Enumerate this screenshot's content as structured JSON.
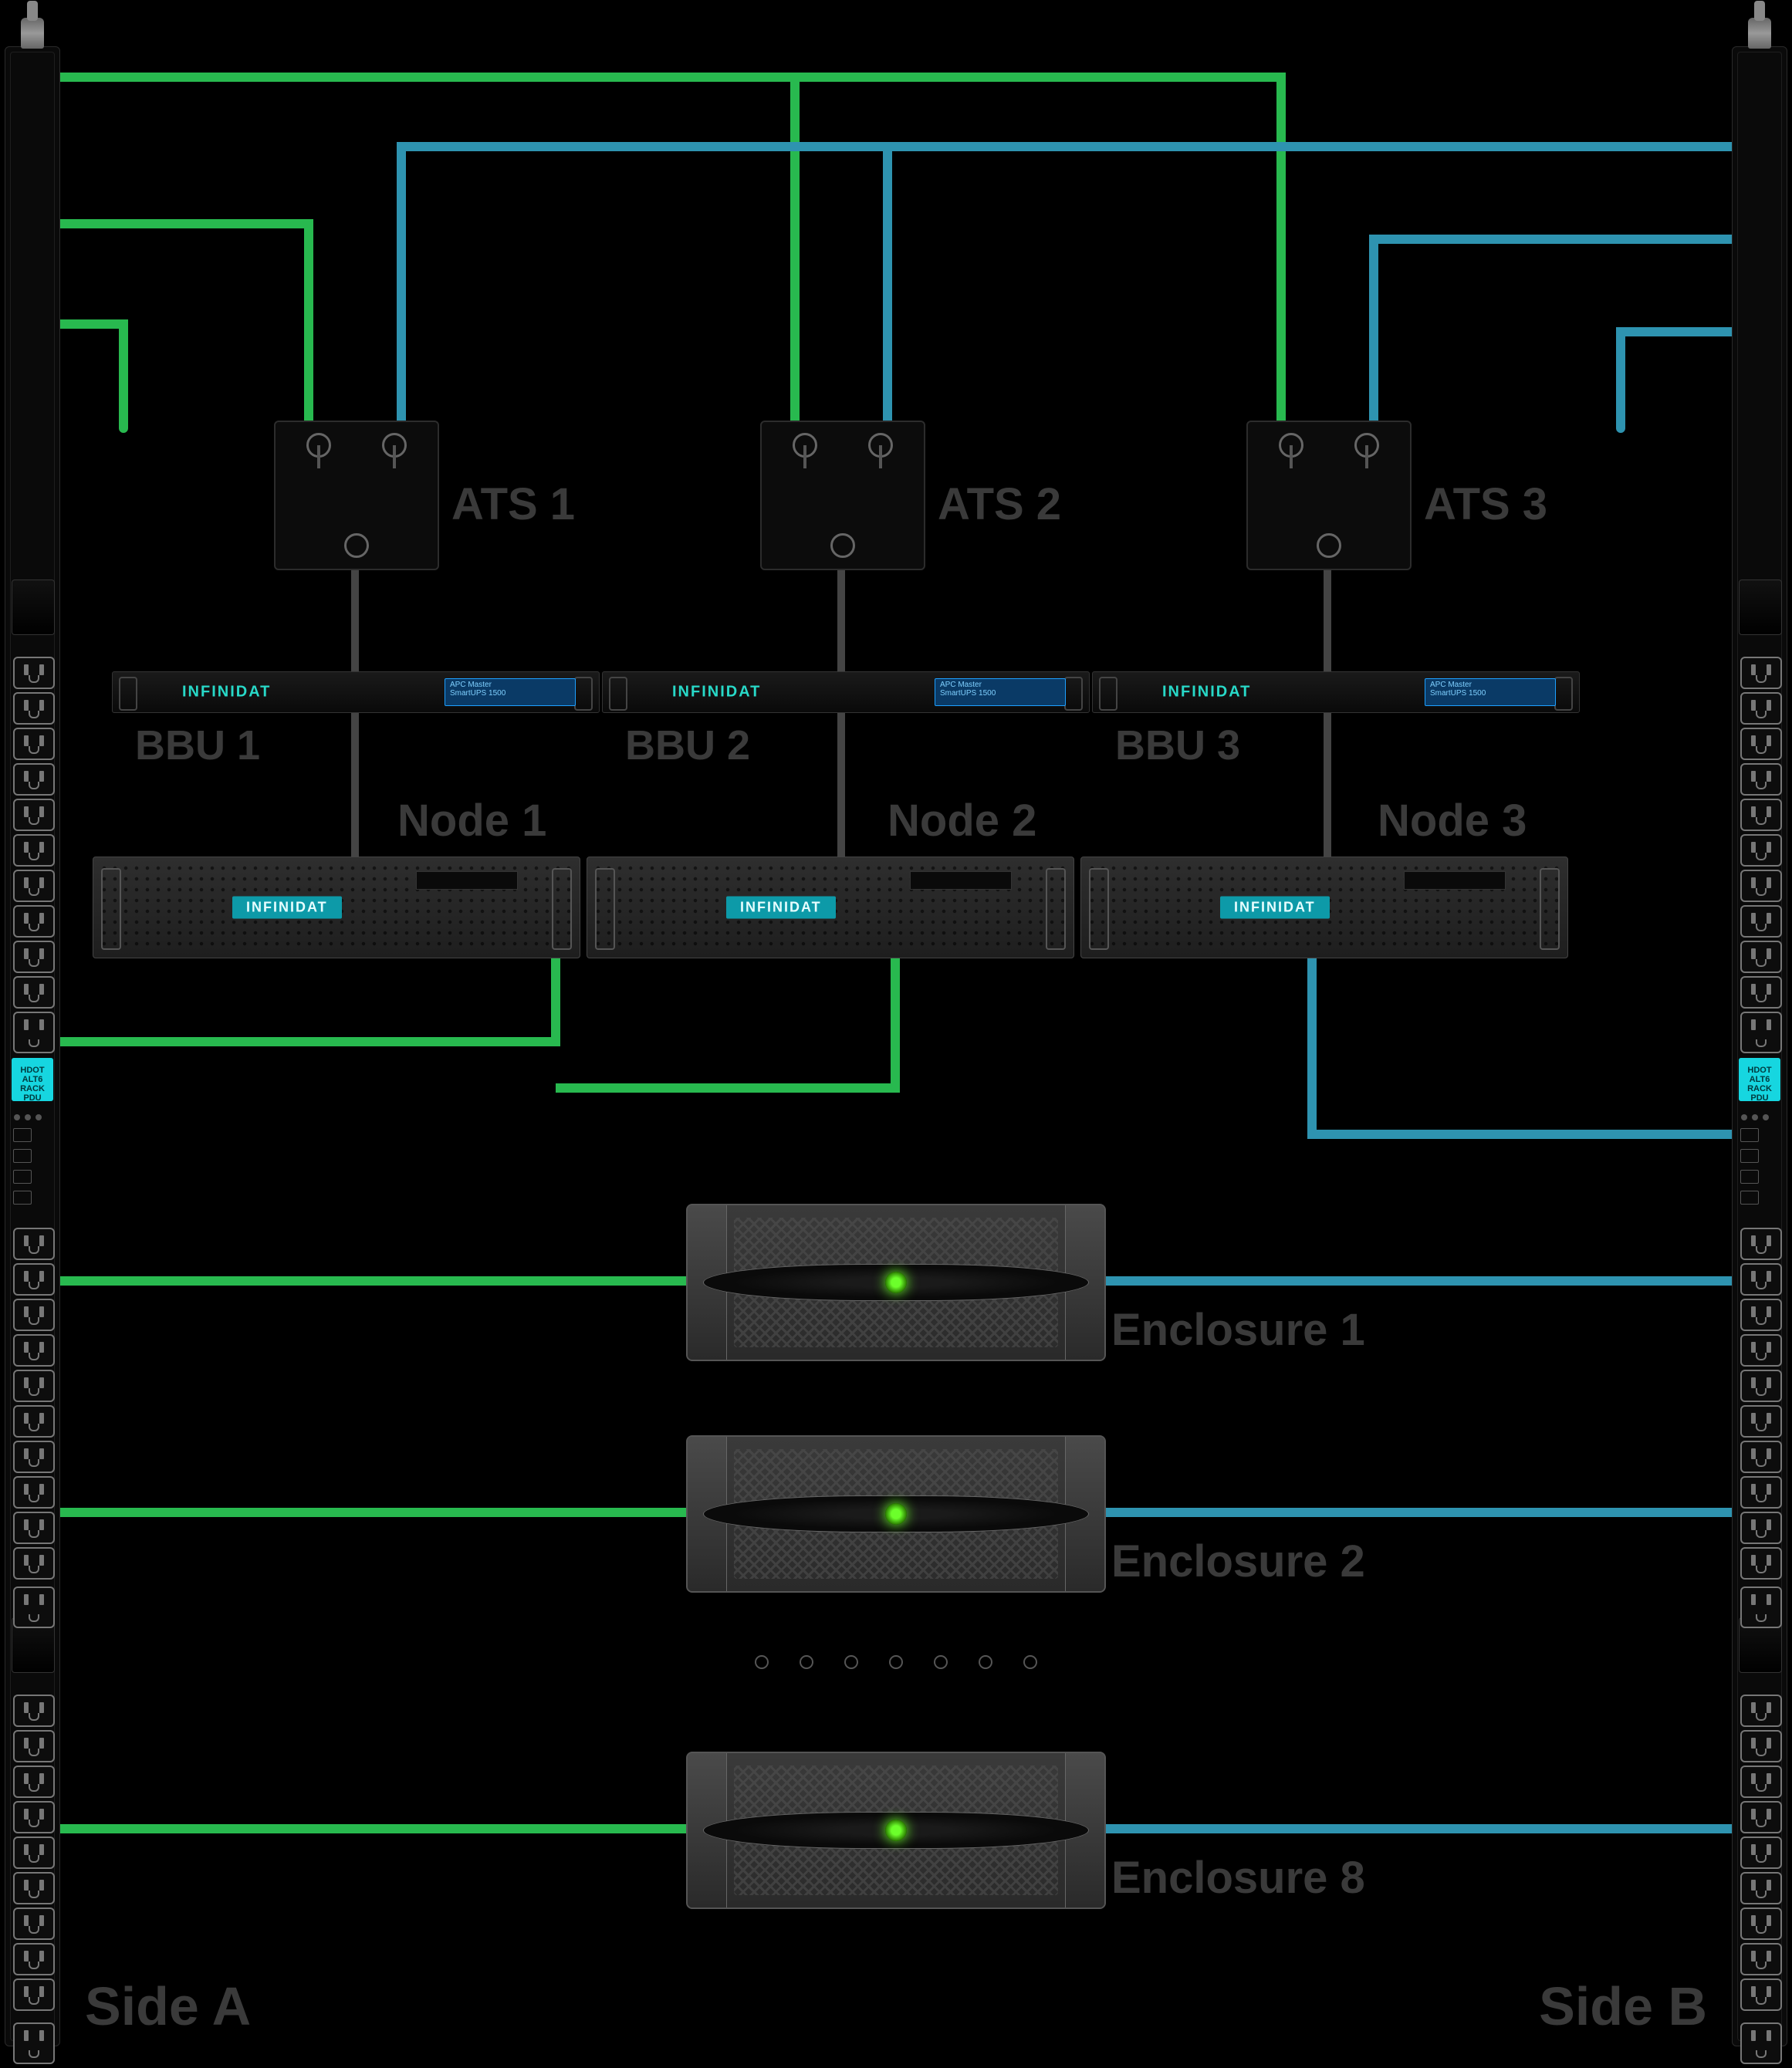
{
  "colors": {
    "sideA": "#28b94f",
    "sideB": "#2e93b0",
    "accent": "#17d6e0"
  },
  "pdu": {
    "display_label": "HDOT ALT6\nRACK PDU",
    "sideA_label": "Side A",
    "sideB_label": "Side B"
  },
  "ats": [
    {
      "label": "ATS 1"
    },
    {
      "label": "ATS 2"
    },
    {
      "label": "ATS 3"
    }
  ],
  "bbu": {
    "brand": "INFINIDAT",
    "screen_line1": "APC Master",
    "screen_line2": "SmartUPS 1500",
    "items": [
      {
        "label": "BBU 1"
      },
      {
        "label": "BBU 2"
      },
      {
        "label": "BBU 3"
      }
    ]
  },
  "nodes": {
    "brand": "INFINIDAT",
    "items": [
      {
        "label": "Node 1"
      },
      {
        "label": "Node 2"
      },
      {
        "label": "Node 3"
      }
    ]
  },
  "enclosures": [
    {
      "label": "Enclosure 1"
    },
    {
      "label": "Enclosure 2"
    },
    {
      "label": "Enclosure 8"
    }
  ]
}
